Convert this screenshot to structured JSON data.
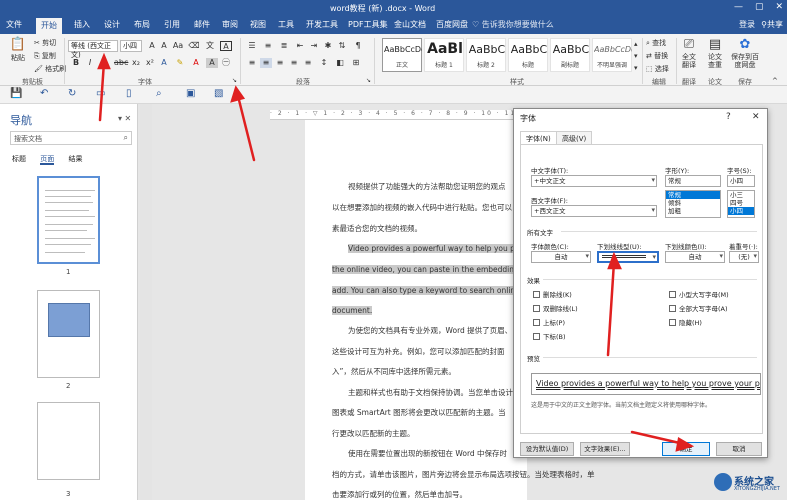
{
  "window": {
    "title": "word教程 (新) .docx - Word",
    "controls": [
      "—",
      "▢",
      "✕"
    ]
  },
  "tabs": [
    "文件",
    "开始",
    "插入",
    "设计",
    "布局",
    "引用",
    "邮件",
    "审阅",
    "视图",
    "工具",
    "开发工具",
    "PDF工具集",
    "金山文档",
    "百度网盘"
  ],
  "tell_me": "告诉我你想要做什么",
  "account": {
    "login": "登录",
    "share": "共享"
  },
  "ribbon": {
    "clipboard": {
      "paste": "粘贴",
      "cut": "剪切",
      "copy": "复制",
      "painter": "格式刷",
      "label": "剪贴板"
    },
    "font": {
      "name": "等线 (西文正文)",
      "size": "小四",
      "label": "字体"
    },
    "paragraph": {
      "label": "段落"
    },
    "styles": {
      "label": "样式",
      "items": [
        {
          "sample": "AaBbCcDd",
          "name": "正文"
        },
        {
          "sample": "AaBl",
          "name": "标题 1"
        },
        {
          "sample": "AaBbC",
          "name": "标题 2"
        },
        {
          "sample": "AaBbC",
          "name": "标题"
        },
        {
          "sample": "AaBbC",
          "name": "副标题"
        },
        {
          "sample": "AaBbCcDd",
          "name": "不明显强调"
        }
      ]
    },
    "editing": {
      "find": "查找",
      "replace": "替换",
      "select": "选择",
      "label": "编辑"
    },
    "fulltext": {
      "label": "全文翻译"
    },
    "paper": {
      "label": "论文查重"
    },
    "save": {
      "label": "保存到百度网盘",
      "group": "保存"
    },
    "translate_group": "翻译",
    "paper_group": "论文"
  },
  "nav": {
    "title": "导航",
    "search_placeholder": "搜索文档",
    "tabs": [
      "标题",
      "页面",
      "结果"
    ],
    "pages": [
      "1",
      "2",
      "3"
    ]
  },
  "document": {
    "paragraphs": [
      "视频提供了功能强大的方法帮助您证明您的观点",
      "以在想要添加的视频的嵌入代码中进行粘贴。您也可以",
      "素最适合您的文档的视频。",
      "Video provides a powerful way to help you prove",
      "the online video, you can paste in the embedding cod",
      "add. You can also type a keyword to search online for",
      "document.",
      "为使您的文档具有专业外观，Word 提供了页眉、",
      "这些设计可互为补充。例如，您可以添加匹配的封面",
      "入”，然后从不同库中选择所需元素。",
      "主题和样式也有助于文档保持协调。当您单击设计",
      "图表或 SmartArt 图形将会更改以匹配新的主题。当",
      "行更改以匹配新的主题。",
      "使用在需要位置出现的新按钮在 Word 中保存时",
      "档的方式，请单击该图片，图片旁边将会显示布局选项按钮。当处理表格时，单",
      "击要添加行或列的位置，然后单击加号。"
    ]
  },
  "dialog": {
    "title": "字体",
    "help": "?",
    "close": "✕",
    "tabs": [
      "字体(N)",
      "高级(V)"
    ],
    "chinese_font": {
      "label": "中文字体(T):",
      "value": "+中文正文"
    },
    "western_font": {
      "label": "西文字体(F):",
      "value": "+西文正文"
    },
    "style": {
      "label": "字形(Y):",
      "value": "常规",
      "options": [
        "常规",
        "倾斜",
        "加粗"
      ]
    },
    "size": {
      "label": "字号(S):",
      "value": "小四",
      "options": [
        "小三",
        "四号",
        "小四"
      ]
    },
    "all_text": "所有文字",
    "font_color": {
      "label": "字体颜色(C):",
      "value": "自动"
    },
    "underline_type": {
      "label": "下划线线型(U):"
    },
    "underline_color": {
      "label": "下划线颜色(I):",
      "value": "自动"
    },
    "emphasis": {
      "label": "着重号(·):",
      "value": "(无)"
    },
    "effects": {
      "label": "效果",
      "left": [
        "删除线(K)",
        "双删除线(L)",
        "上标(P)",
        "下标(B)"
      ],
      "right": [
        "小型大写字母(M)",
        "全部大写字母(A)",
        "隐藏(H)"
      ]
    },
    "preview": {
      "label": "预览",
      "text": "Video provides a powerful way to help you prove your point.",
      "note": "这是用于中文的正文主题字体。当前文档主题定义将使用哪种字体。"
    },
    "buttons": {
      "default": "设为默认值(D)",
      "effects": "文字效果(E)...",
      "ok": "确定",
      "cancel": "取消"
    }
  },
  "watermark": {
    "title": "系统之家",
    "sub": "XITONGZHIJIA.NET"
  },
  "colors": {
    "accent": "#2b579a",
    "arrow": "#e02020",
    "selection": "#0078d7"
  }
}
